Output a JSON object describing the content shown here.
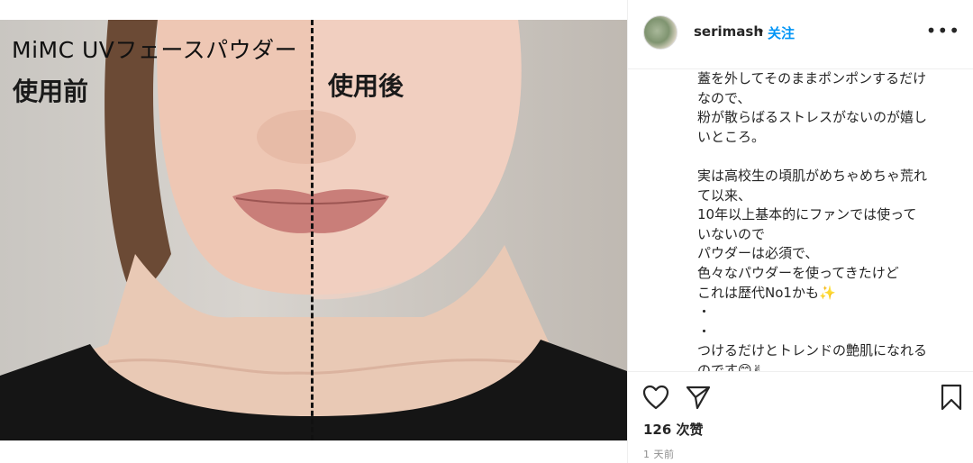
{
  "post": {
    "photo": {
      "title": "MiMC UVフェースパウダー",
      "label_before": "使用前",
      "label_after": "使用後"
    }
  },
  "header": {
    "username": "serimash",
    "separator": "•",
    "follow_label": "关注",
    "more_label": "•••"
  },
  "caption": {
    "lines": [
      "蓋を外してそのままポンポンするだけ",
      "なので、",
      "粉が散らばるストレスがないのが嬉し",
      "いところ。",
      "",
      "実は高校生の頃肌がめちゃめちゃ荒れ",
      "て以来、",
      "10年以上基本的にファンでは使って",
      "いないので",
      "パウダーは必須で、",
      "色々なパウダーを使ってきたけど",
      "これは歴代No1かも✨",
      "・",
      "・",
      "つけるだけとトレンドの艶肌になれる",
      "のです😊✌"
    ]
  },
  "actions": {
    "like_icon": "heart-icon",
    "share_icon": "paper-plane-icon",
    "save_icon": "bookmark-icon"
  },
  "likes": {
    "label": "126 次赞"
  },
  "time": {
    "label": "1 天前"
  }
}
